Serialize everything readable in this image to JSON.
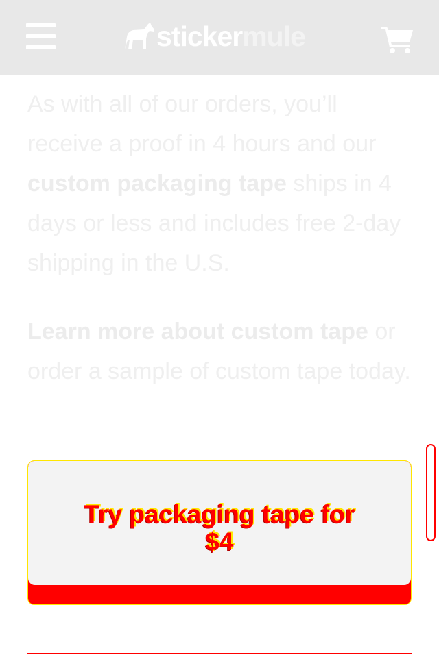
{
  "header": {
    "logo_part1": "sticker",
    "logo_part2": "mule",
    "menu_icon": "hamburger-menu-icon",
    "cart_icon": "shopping-cart-icon",
    "logo_icon": "mule-horse-icon"
  },
  "content": {
    "paragraph1": {
      "text_before": "As with all of our orders, you’ll receive a proof in 4 hours and our ",
      "bold": "custom packaging tape",
      "text_after": " ships in 4 days or less and includes free 2-day shipping in the U.S."
    },
    "paragraph2": {
      "link": "Learn more about custom tape",
      "text_after": " or order a sample of custom tape today."
    }
  },
  "cta": {
    "label": "Try packaging tape for $4"
  },
  "colors": {
    "header_bg": "#e8e8e8",
    "cta_accent": "#ff0000",
    "cta_outline": "#ffe600",
    "cta_face": "#f3f3f3"
  }
}
